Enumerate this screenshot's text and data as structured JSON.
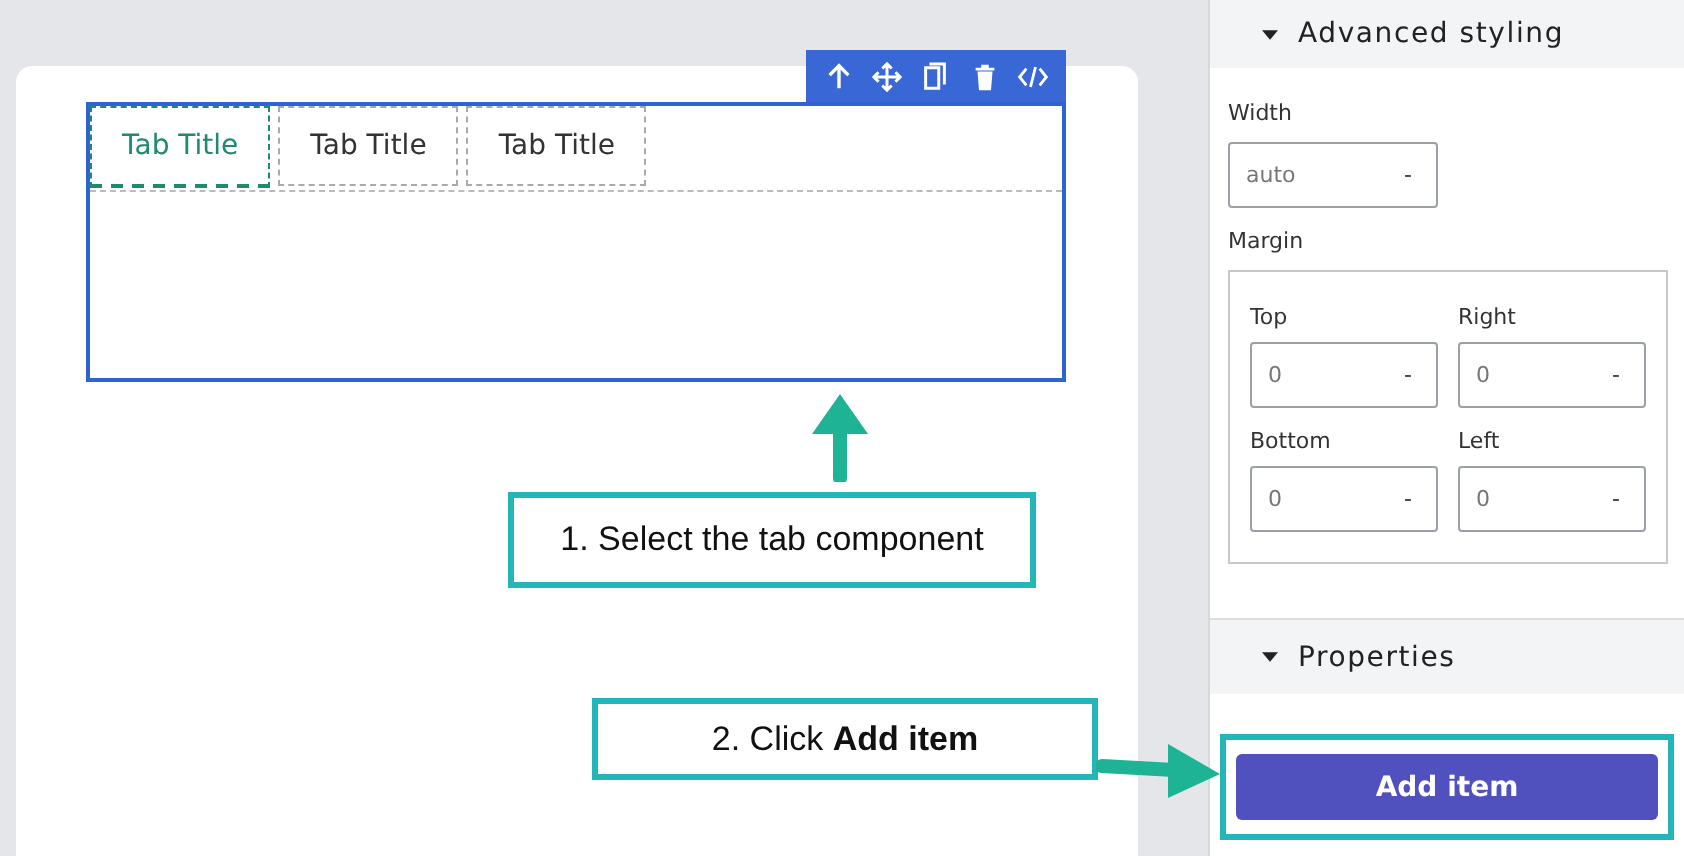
{
  "canvas": {
    "tabs": [
      {
        "label": "Tab Title",
        "selected": true
      },
      {
        "label": "Tab Title",
        "selected": false
      },
      {
        "label": "Tab Title",
        "selected": false
      }
    ]
  },
  "callouts": [
    {
      "text": "1. Select the tab component"
    },
    {
      "text": "2. Click **Add item**"
    }
  ],
  "panel": {
    "advanced_styling": {
      "title": "Advanced styling",
      "expanded": true,
      "width": {
        "label": "Width",
        "value": "auto",
        "unit": "-"
      },
      "margin": {
        "label": "Margin",
        "fields": [
          {
            "label": "Top",
            "value": "0",
            "unit": "-"
          },
          {
            "label": "Right",
            "value": "0",
            "unit": "-"
          },
          {
            "label": "Bottom",
            "value": "0",
            "unit": "-"
          },
          {
            "label": "Left",
            "value": "0",
            "unit": "-"
          }
        ]
      }
    },
    "properties": {
      "title": "Properties",
      "expanded": true,
      "button": "Add item"
    }
  }
}
